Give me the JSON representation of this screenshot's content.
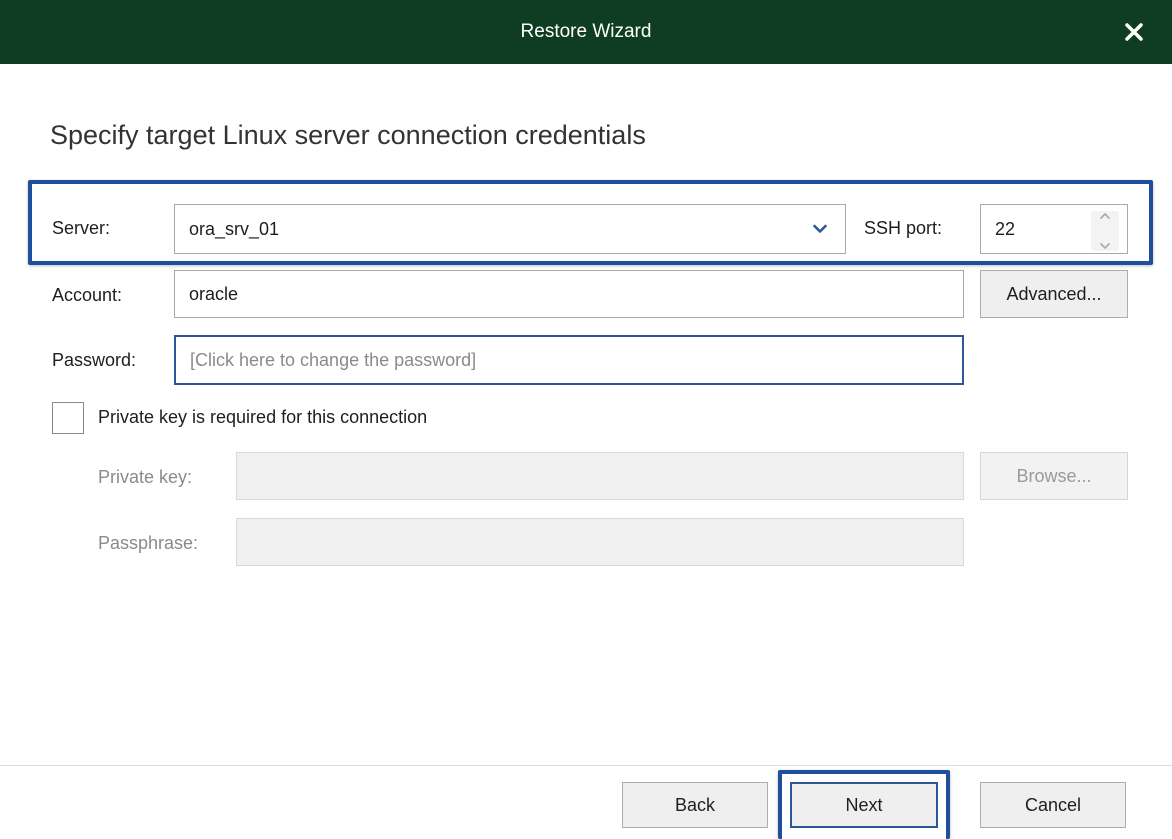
{
  "window": {
    "title": "Restore Wizard",
    "close_icon": "close-icon"
  },
  "heading": "Specify target Linux server connection credentials",
  "server": {
    "label": "Server:",
    "value": "ora_srv_01"
  },
  "ssh_port": {
    "label": "SSH port:",
    "value": "22"
  },
  "account": {
    "label": "Account:",
    "value": "oracle",
    "advanced_label": "Advanced..."
  },
  "password": {
    "label": "Password:",
    "placeholder": "[Click here to change the password]"
  },
  "private_key_checkbox": {
    "label": "Private key is required for this connection",
    "checked": false
  },
  "private_key": {
    "label": "Private key:",
    "value": "",
    "browse_label": "Browse..."
  },
  "passphrase": {
    "label": "Passphrase:",
    "value": ""
  },
  "footer": {
    "back_label": "Back",
    "next_label": "Next",
    "cancel_label": "Cancel"
  },
  "colors": {
    "titlebar": "#0f3d23",
    "highlight": "#1f4e9c",
    "focus": "#2b5797"
  }
}
